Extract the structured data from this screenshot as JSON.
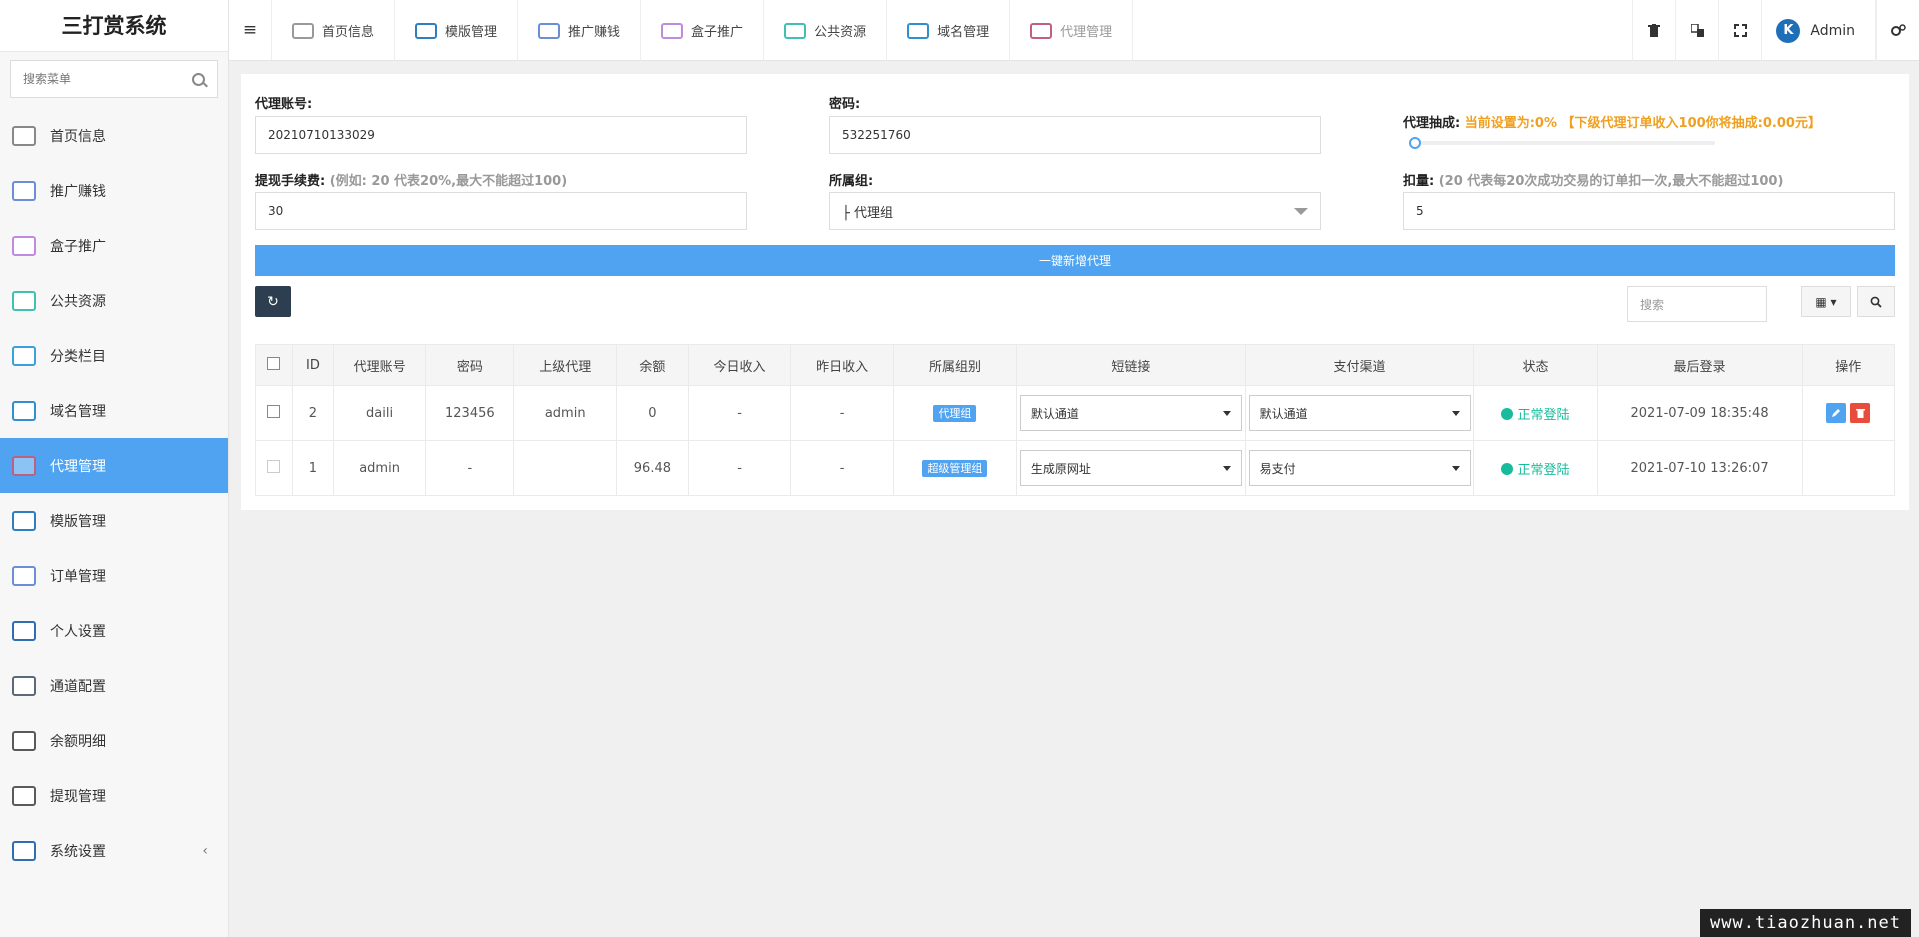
{
  "app": {
    "title": "三打赏系统"
  },
  "sidebar": {
    "search_placeholder": "搜索菜单",
    "items": [
      {
        "label": "首页信息",
        "icon": "home-card-icon",
        "color": "#888"
      },
      {
        "label": "推广赚钱",
        "icon": "megaphone-icon",
        "color": "#6a8fd6"
      },
      {
        "label": "盒子推广",
        "icon": "box-icon",
        "color": "#c08ae0"
      },
      {
        "label": "公共资源",
        "icon": "network-icon",
        "color": "#40c0b0"
      },
      {
        "label": "分类栏目",
        "icon": "sort-icon",
        "color": "#3aa0e0"
      },
      {
        "label": "域名管理",
        "icon": "domain-icon",
        "color": "#2f8fd0"
      },
      {
        "label": "代理管理",
        "icon": "agent-cart-icon",
        "color": "#c06080"
      },
      {
        "label": "模版管理",
        "icon": "template-icon",
        "color": "#2f7fc0"
      },
      {
        "label": "订单管理",
        "icon": "order-icon",
        "color": "#6a8fd6"
      },
      {
        "label": "个人设置",
        "icon": "settings-card-icon",
        "color": "#2f6fb0"
      },
      {
        "label": "通道配置",
        "icon": "channel-icon",
        "color": "#5a6a7a"
      },
      {
        "label": "余额明细",
        "icon": "balance-icon",
        "color": "#5a5a5a"
      },
      {
        "label": "提现管理",
        "icon": "withdraw-icon",
        "color": "#5a5a5a"
      },
      {
        "label": "系统设置",
        "icon": "system-icon",
        "color": "#2f6fb0"
      }
    ],
    "active_index": 6,
    "collapse_arrow": "‹"
  },
  "topbar": {
    "menu_toggle": "≡",
    "tabs": [
      {
        "label": "首页信息",
        "color": "#999"
      },
      {
        "label": "模版管理",
        "color": "#2f7fc0"
      },
      {
        "label": "推广赚钱",
        "color": "#6a8fd6"
      },
      {
        "label": "盒子推广",
        "color": "#c08ae0"
      },
      {
        "label": "公共资源",
        "color": "#40c0b0"
      },
      {
        "label": "域名管理",
        "color": "#2f8fd0"
      },
      {
        "label": "代理管理",
        "color": "#c06080"
      }
    ],
    "admin_initial": "K",
    "admin_name": "Admin"
  },
  "form": {
    "account_label": "代理账号:",
    "account_value": "20210710133029",
    "password_label": "密码:",
    "password_value": "532251760",
    "commission_label": "代理抽成:",
    "commission_info": "当前设置为:0% 【下级代理订单收入100你将抽成:0.00元】",
    "commission_percent": 0,
    "fee_label": "提现手续费:",
    "fee_hint": "(例如: 20 代表20%,最大不能超过100)",
    "fee_value": "30",
    "group_label": "所属组:",
    "group_value": "├ 代理组",
    "deduct_label": "扣量:",
    "deduct_hint": "(20 代表每20次成功交易的订单扣一次,最大不能超过100)",
    "deduct_value": "5",
    "submit_label": "一键新增代理"
  },
  "toolbar": {
    "refresh": "↻",
    "search_placeholder": "搜索",
    "columns_btn": "▦ ▾",
    "search_btn": "⚲"
  },
  "table": {
    "headers": [
      "ID",
      "代理账号",
      "密码",
      "上级代理",
      "余额",
      "今日收入",
      "昨日收入",
      "所属组别",
      "短链接",
      "支付渠道",
      "状态",
      "最后登录",
      "操作"
    ],
    "rows": [
      {
        "id": "2",
        "account": "daili",
        "password": "123456",
        "parent": "admin",
        "balance": "0",
        "today": "-",
        "yesterday": "-",
        "group": "代理组",
        "short_link": "默认通道",
        "pay_channel": "默认通道",
        "status": "正常登陆",
        "last_login": "2021-07-09 18:35:48"
      },
      {
        "id": "1",
        "account": "admin",
        "password": "-",
        "parent": "",
        "balance": "96.48",
        "today": "-",
        "yesterday": "-",
        "group": "超级管理组",
        "short_link": "生成原网址",
        "pay_channel": "易支付",
        "status": "正常登陆",
        "last_login": "2021-07-10 13:26:07"
      }
    ]
  },
  "watermark": "www.tiaozhuan.net"
}
